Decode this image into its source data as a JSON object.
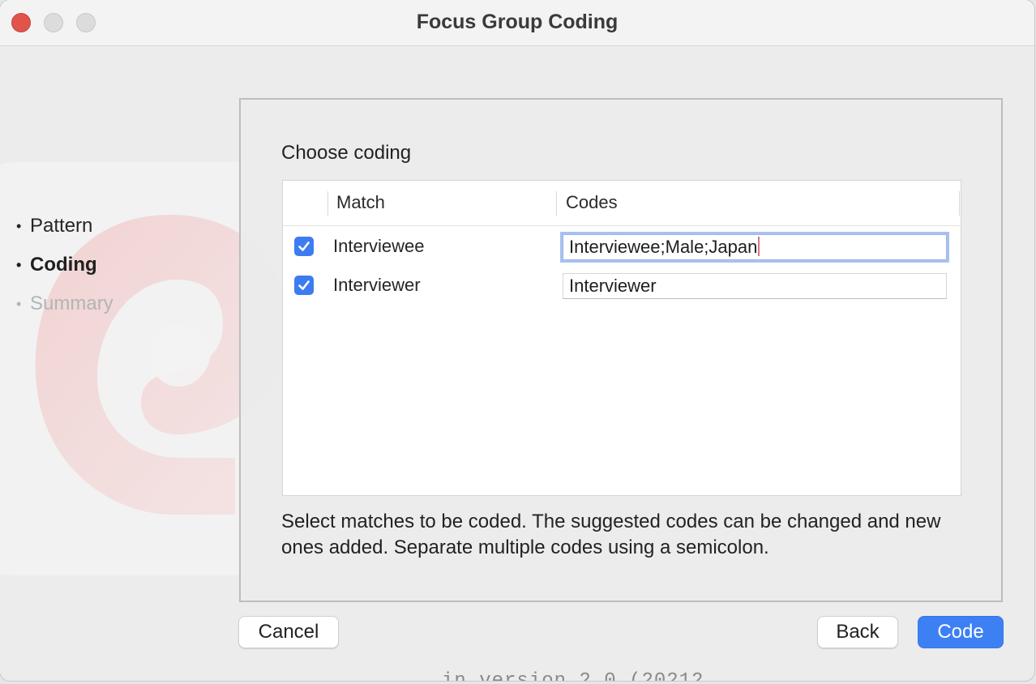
{
  "window": {
    "title": "Focus Group Coding"
  },
  "steps": [
    {
      "label": "Pattern",
      "state": "done"
    },
    {
      "label": "Coding",
      "state": "active"
    },
    {
      "label": "Summary",
      "state": "pending"
    }
  ],
  "panel": {
    "title": "Choose coding",
    "columns": {
      "match": "Match",
      "codes": "Codes"
    },
    "rows": [
      {
        "checked": true,
        "match": "Interviewee",
        "codes": "Interviewee;Male;Japan",
        "focused": true
      },
      {
        "checked": true,
        "match": "Interviewer",
        "codes": "Interviewer",
        "focused": false
      }
    ],
    "hint": "Select matches to be coded. The suggested codes can be changed and new ones added. Separate multiple codes using a semicolon."
  },
  "buttons": {
    "cancel": "Cancel",
    "back": "Back",
    "code": "Code"
  },
  "background_text": "in version 2.0 (20212",
  "colors": {
    "accent": "#3d80f4",
    "close": "#e0544c",
    "logo": "#e25a5a"
  }
}
